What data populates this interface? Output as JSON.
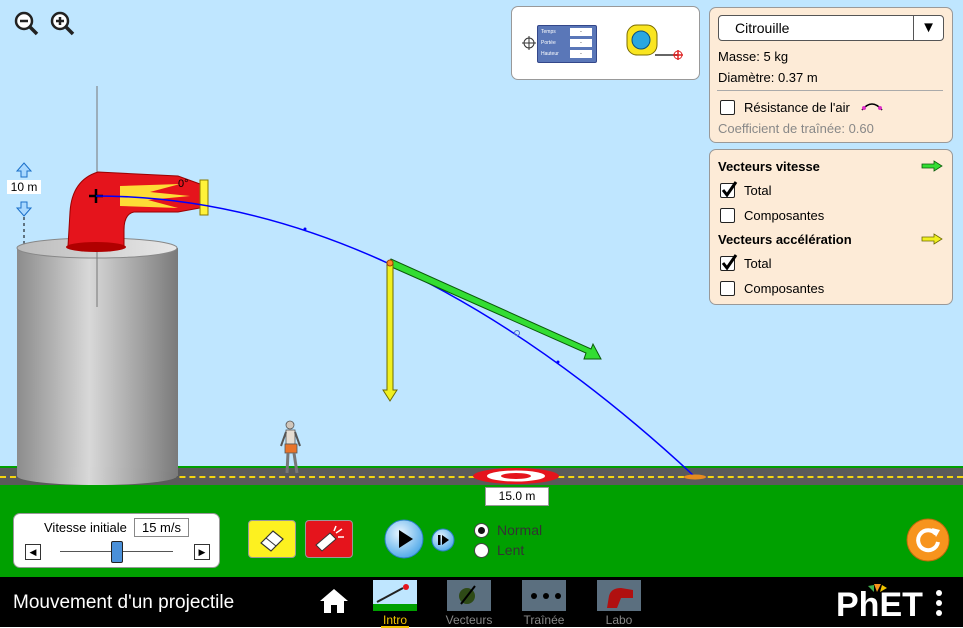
{
  "app": {
    "title": "Mouvement d'un projectile"
  },
  "projectile_panel": {
    "selected": "Citrouille",
    "mass": "Masse: 5 kg",
    "diameter": "Diamètre: 0.37 m",
    "air_resistance_label": "Résistance de l'air",
    "air_resistance_checked": false,
    "drag_coefficient": "Coefficient de traînée: 0.60"
  },
  "vectors_panel": {
    "velocity_title": "Vecteurs vitesse",
    "velocity_total_label": "Total",
    "velocity_total_checked": true,
    "velocity_components_label": "Composantes",
    "velocity_components_checked": false,
    "acceleration_title": "Vecteurs accélération",
    "acceleration_total_label": "Total",
    "acceleration_total_checked": true,
    "acceleration_components_label": "Composantes",
    "acceleration_components_checked": false,
    "velocity_arrow_color": "#33dd33",
    "acceleration_arrow_color": "#f0f020"
  },
  "tools_panel": {
    "readout_rows": [
      {
        "label": "Temps",
        "value": "-"
      },
      {
        "label": "Portée",
        "value": "-"
      },
      {
        "label": "Hauteur",
        "value": "-"
      }
    ]
  },
  "launcher": {
    "height": "10 m",
    "angle": "0°",
    "initial_speed_label": "Vitesse initiale",
    "initial_speed_value": "15 m/s"
  },
  "target": {
    "range": "15.0 m"
  },
  "playback": {
    "speed_options": [
      {
        "label": "Normal",
        "selected": true
      },
      {
        "label": "Lent",
        "selected": false
      }
    ]
  },
  "navbar": {
    "tabs": [
      {
        "label": "Intro",
        "active": true
      },
      {
        "label": "Vecteurs",
        "active": false
      },
      {
        "label": "Traînée",
        "active": false
      },
      {
        "label": "Labo",
        "active": false
      }
    ],
    "logo": "PhET"
  },
  "colors": {
    "sky": "#bfe6ff",
    "grass": "#00a000",
    "panel_bg": "#fdebd7",
    "trajectory": "#0000ff",
    "cannon_red": "#e5141c",
    "reset_orange": "#f7941d",
    "active_tab": "#f2c500"
  },
  "icons": [
    "zoom-out-icon",
    "zoom-in-icon",
    "crosshair-icon",
    "tape-measure-icon",
    "dropdown-arrow-icon",
    "drag-curve-icon",
    "eraser-icon",
    "cannon-fire-icon",
    "play-icon",
    "step-forward-icon",
    "reset-icon",
    "home-icon",
    "menu-dots-icon"
  ]
}
